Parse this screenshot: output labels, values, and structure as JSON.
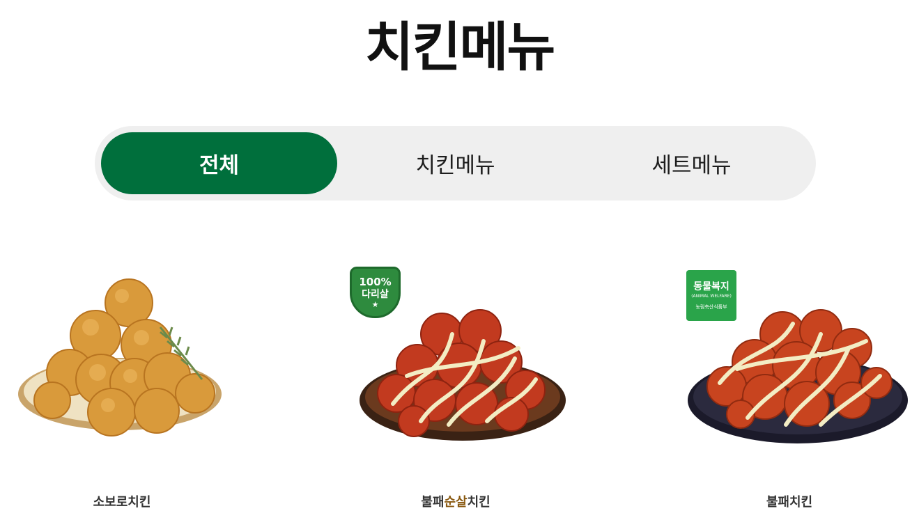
{
  "page": {
    "title": "치킨메뉴"
  },
  "tabs": [
    {
      "label": "전체",
      "active": true
    },
    {
      "label": "치킨메뉴",
      "active": false
    },
    {
      "label": "세트메뉴",
      "active": false
    }
  ],
  "products": [
    {
      "name": "소보로치킨",
      "image": "fried-chicken-plate",
      "badge": null
    },
    {
      "name_parts": [
        "불패",
        "순살",
        "치킨"
      ],
      "image": "spicy-boneless-chicken-plate",
      "badge": {
        "line1": "100%",
        "line2": "다리살",
        "icon": "star-icon",
        "color": "#2e8b3e"
      }
    },
    {
      "name": "불패치킨",
      "image": "spicy-chicken-plate",
      "badge": {
        "line1": "동물복지",
        "line2": "(ANIMAL WELFARE)",
        "line3": "농림축산식품부",
        "color": "#2aa44a"
      }
    }
  ],
  "colors": {
    "accent": "#006f3c",
    "tab_bg": "#efefef",
    "name_highlight": "#8a5a12"
  }
}
